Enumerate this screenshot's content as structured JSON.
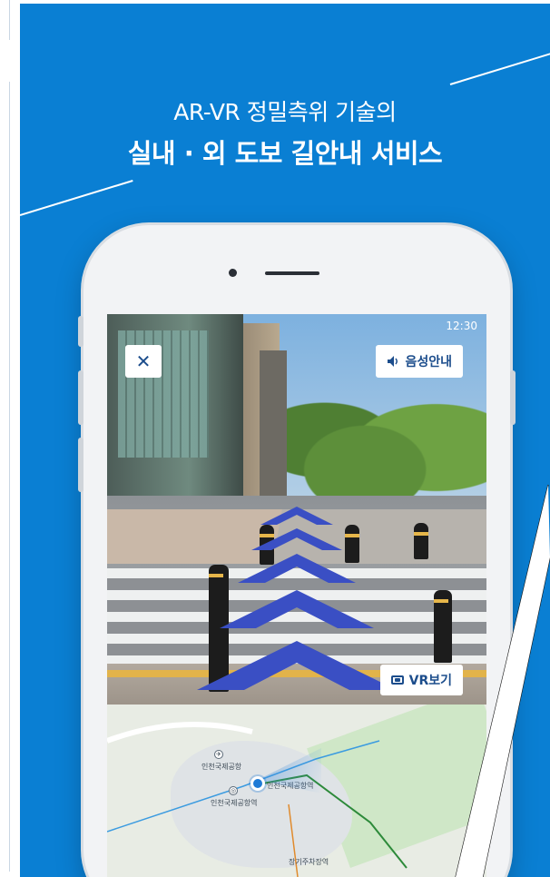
{
  "headline": {
    "line1": "AR-VR 정밀측위 기술의",
    "line2": "실내 · 외 도보 길안내 서비스"
  },
  "screen": {
    "status_time": "12:30",
    "close_label": "✕",
    "voice_label": "음성안내",
    "vr_label": "VR보기"
  },
  "map": {
    "labels": [
      "인천국제공항",
      "인천국제공항역",
      "인천국제공항역",
      "장기주차장역"
    ]
  },
  "colors": {
    "banner": "#0a7fd3",
    "accent": "#1c4d8c",
    "chevron": "#3a4fc4"
  },
  "icons": [
    "close-icon",
    "speaker-icon",
    "vr-icon",
    "location-dot-icon",
    "airport-icon"
  ]
}
